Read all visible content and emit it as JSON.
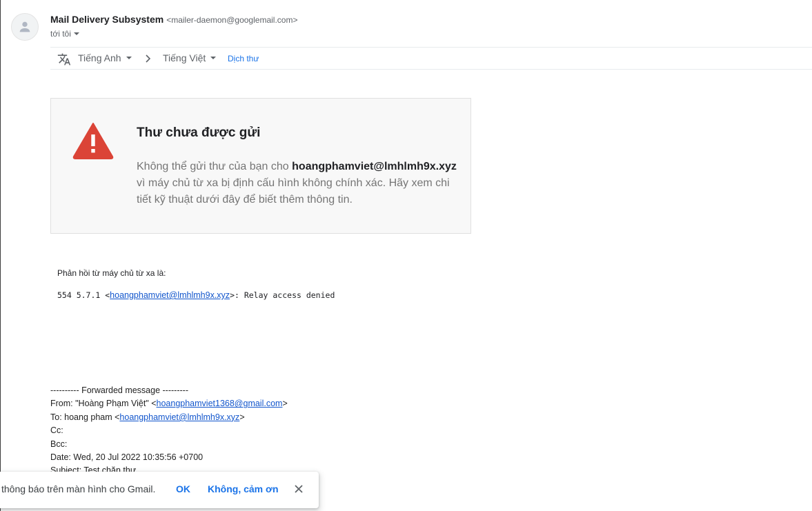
{
  "sender": {
    "name": "Mail Delivery Subsystem",
    "email": "<mailer-daemon@googlemail.com>",
    "to_label": "tới tôi"
  },
  "translate": {
    "source_lang": "Tiếng Anh",
    "target_lang": "Tiếng Việt",
    "action": "Dịch thư"
  },
  "bounce": {
    "title": "Thư chưa được gửi",
    "text_before": "Không thể gửi thư của bạn cho ",
    "recipient": "hoangphamviet@lmhlmh9x.xyz",
    "text_after": " vì máy chủ từ xa bị định cấu hình không chính xác. Hãy xem chi tiết kỹ thuật dưới đây để biết thêm thông tin."
  },
  "remote": {
    "label": "Phản hồi từ máy chủ từ xa là:",
    "code_prefix": "554 5.7.1 <",
    "code_link": "hoangphamviet@lmhlmh9x.xyz",
    "code_suffix": ">: Relay access denied"
  },
  "forwarded": {
    "header": "---------- Forwarded message ---------",
    "from_prefix": "From: \"Hoàng Phạm Việt\" <",
    "from_link": "hoangphamviet1368@gmail.com",
    "from_suffix": ">",
    "to_prefix": "To: hoang pham <",
    "to_link": "hoangphamviet@lmhlmh9x.xyz",
    "to_suffix": ">",
    "cc": "Cc:",
    "bcc": "Bcc:",
    "date": "Date: Wed, 20 Jul 2022 10:35:56 +0700",
    "subject": "Subject: Test chặn thư"
  },
  "notification": {
    "text": "thông báo trên màn hình cho Gmail.",
    "ok_label": "OK",
    "decline_label": "Không, cảm ơn"
  },
  "colors": {
    "accent": "#1a73e8",
    "link": "#1155cc",
    "warning": "#db4437"
  }
}
